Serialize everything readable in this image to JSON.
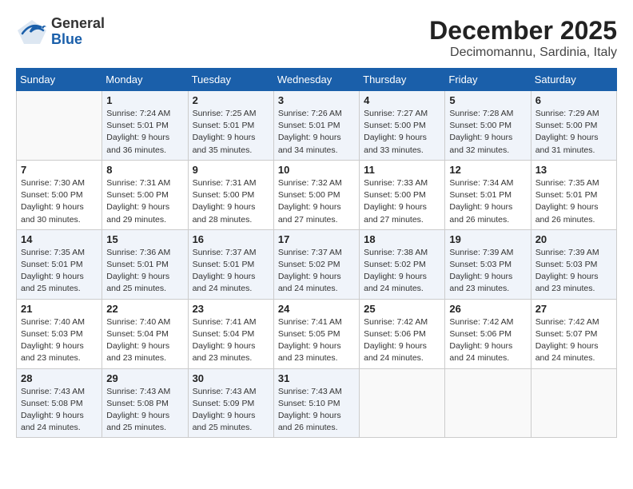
{
  "header": {
    "logo": {
      "line1": "General",
      "line2": "Blue"
    },
    "title": "December 2025",
    "subtitle": "Decimomannu, Sardinia, Italy"
  },
  "weekdays": [
    "Sunday",
    "Monday",
    "Tuesday",
    "Wednesday",
    "Thursday",
    "Friday",
    "Saturday"
  ],
  "weeks": [
    [
      {
        "day": "",
        "info": ""
      },
      {
        "day": "1",
        "info": "Sunrise: 7:24 AM\nSunset: 5:01 PM\nDaylight: 9 hours\nand 36 minutes."
      },
      {
        "day": "2",
        "info": "Sunrise: 7:25 AM\nSunset: 5:01 PM\nDaylight: 9 hours\nand 35 minutes."
      },
      {
        "day": "3",
        "info": "Sunrise: 7:26 AM\nSunset: 5:01 PM\nDaylight: 9 hours\nand 34 minutes."
      },
      {
        "day": "4",
        "info": "Sunrise: 7:27 AM\nSunset: 5:00 PM\nDaylight: 9 hours\nand 33 minutes."
      },
      {
        "day": "5",
        "info": "Sunrise: 7:28 AM\nSunset: 5:00 PM\nDaylight: 9 hours\nand 32 minutes."
      },
      {
        "day": "6",
        "info": "Sunrise: 7:29 AM\nSunset: 5:00 PM\nDaylight: 9 hours\nand 31 minutes."
      }
    ],
    [
      {
        "day": "7",
        "info": "Sunrise: 7:30 AM\nSunset: 5:00 PM\nDaylight: 9 hours\nand 30 minutes."
      },
      {
        "day": "8",
        "info": "Sunrise: 7:31 AM\nSunset: 5:00 PM\nDaylight: 9 hours\nand 29 minutes."
      },
      {
        "day": "9",
        "info": "Sunrise: 7:31 AM\nSunset: 5:00 PM\nDaylight: 9 hours\nand 28 minutes."
      },
      {
        "day": "10",
        "info": "Sunrise: 7:32 AM\nSunset: 5:00 PM\nDaylight: 9 hours\nand 27 minutes."
      },
      {
        "day": "11",
        "info": "Sunrise: 7:33 AM\nSunset: 5:00 PM\nDaylight: 9 hours\nand 27 minutes."
      },
      {
        "day": "12",
        "info": "Sunrise: 7:34 AM\nSunset: 5:01 PM\nDaylight: 9 hours\nand 26 minutes."
      },
      {
        "day": "13",
        "info": "Sunrise: 7:35 AM\nSunset: 5:01 PM\nDaylight: 9 hours\nand 26 minutes."
      }
    ],
    [
      {
        "day": "14",
        "info": "Sunrise: 7:35 AM\nSunset: 5:01 PM\nDaylight: 9 hours\nand 25 minutes."
      },
      {
        "day": "15",
        "info": "Sunrise: 7:36 AM\nSunset: 5:01 PM\nDaylight: 9 hours\nand 25 minutes."
      },
      {
        "day": "16",
        "info": "Sunrise: 7:37 AM\nSunset: 5:01 PM\nDaylight: 9 hours\nand 24 minutes."
      },
      {
        "day": "17",
        "info": "Sunrise: 7:37 AM\nSunset: 5:02 PM\nDaylight: 9 hours\nand 24 minutes."
      },
      {
        "day": "18",
        "info": "Sunrise: 7:38 AM\nSunset: 5:02 PM\nDaylight: 9 hours\nand 24 minutes."
      },
      {
        "day": "19",
        "info": "Sunrise: 7:39 AM\nSunset: 5:03 PM\nDaylight: 9 hours\nand 23 minutes."
      },
      {
        "day": "20",
        "info": "Sunrise: 7:39 AM\nSunset: 5:03 PM\nDaylight: 9 hours\nand 23 minutes."
      }
    ],
    [
      {
        "day": "21",
        "info": "Sunrise: 7:40 AM\nSunset: 5:03 PM\nDaylight: 9 hours\nand 23 minutes."
      },
      {
        "day": "22",
        "info": "Sunrise: 7:40 AM\nSunset: 5:04 PM\nDaylight: 9 hours\nand 23 minutes."
      },
      {
        "day": "23",
        "info": "Sunrise: 7:41 AM\nSunset: 5:04 PM\nDaylight: 9 hours\nand 23 minutes."
      },
      {
        "day": "24",
        "info": "Sunrise: 7:41 AM\nSunset: 5:05 PM\nDaylight: 9 hours\nand 23 minutes."
      },
      {
        "day": "25",
        "info": "Sunrise: 7:42 AM\nSunset: 5:06 PM\nDaylight: 9 hours\nand 24 minutes."
      },
      {
        "day": "26",
        "info": "Sunrise: 7:42 AM\nSunset: 5:06 PM\nDaylight: 9 hours\nand 24 minutes."
      },
      {
        "day": "27",
        "info": "Sunrise: 7:42 AM\nSunset: 5:07 PM\nDaylight: 9 hours\nand 24 minutes."
      }
    ],
    [
      {
        "day": "28",
        "info": "Sunrise: 7:43 AM\nSunset: 5:08 PM\nDaylight: 9 hours\nand 24 minutes."
      },
      {
        "day": "29",
        "info": "Sunrise: 7:43 AM\nSunset: 5:08 PM\nDaylight: 9 hours\nand 25 minutes."
      },
      {
        "day": "30",
        "info": "Sunrise: 7:43 AM\nSunset: 5:09 PM\nDaylight: 9 hours\nand 25 minutes."
      },
      {
        "day": "31",
        "info": "Sunrise: 7:43 AM\nSunset: 5:10 PM\nDaylight: 9 hours\nand 26 minutes."
      },
      {
        "day": "",
        "info": ""
      },
      {
        "day": "",
        "info": ""
      },
      {
        "day": "",
        "info": ""
      }
    ]
  ]
}
